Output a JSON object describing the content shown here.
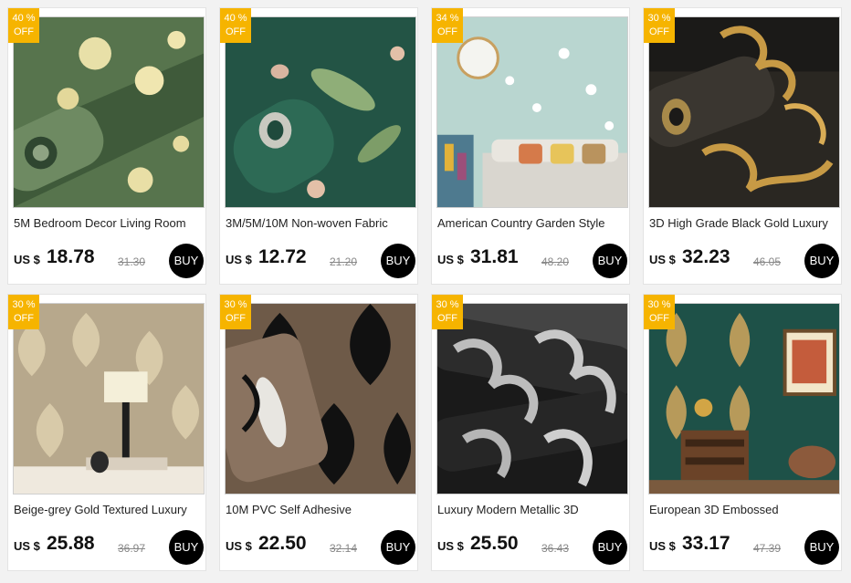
{
  "products": [
    {
      "discount_value": "40 %",
      "discount_label": "OFF",
      "title": "5M Bedroom Decor Living Room",
      "currency": "US $",
      "price": "18.78",
      "old_price": "31.30",
      "buy_label": "BUY",
      "image_icon": "green-floral-wallpaper-roll"
    },
    {
      "discount_value": "40 %",
      "discount_label": "OFF",
      "title": "3M/5M/10M Non-woven Fabric",
      "currency": "US $",
      "price": "12.72",
      "old_price": "21.20",
      "buy_label": "BUY",
      "image_icon": "teal-bird-leaf-wallpaper-roll"
    },
    {
      "discount_value": "34 %",
      "discount_label": "OFF",
      "title": "American Country Garden Style",
      "currency": "US $",
      "price": "31.81",
      "old_price": "48.20",
      "buy_label": "BUY",
      "image_icon": "floral-wall-living-room"
    },
    {
      "discount_value": "30 %",
      "discount_label": "OFF",
      "title": "3D High Grade Black Gold Luxury",
      "currency": "US $",
      "price": "32.23",
      "old_price": "46.05",
      "buy_label": "BUY",
      "image_icon": "black-gold-damask-roll"
    },
    {
      "discount_value": "30 %",
      "discount_label": "OFF",
      "title": "Beige-grey Gold Textured Luxury",
      "currency": "US $",
      "price": "25.88",
      "old_price": "36.97",
      "buy_label": "BUY",
      "image_icon": "beige-damask-bedroom"
    },
    {
      "discount_value": "30 %",
      "discount_label": "OFF",
      "title": "10M PVC Self Adhesive",
      "currency": "US $",
      "price": "22.50",
      "old_price": "32.14",
      "buy_label": "BUY",
      "image_icon": "black-damask-adhesive-roll"
    },
    {
      "discount_value": "30 %",
      "discount_label": "OFF",
      "title": "Luxury Modern Metallic 3D",
      "currency": "US $",
      "price": "25.50",
      "old_price": "36.43",
      "buy_label": "BUY",
      "image_icon": "silver-black-damask-rolls"
    },
    {
      "discount_value": "30 %",
      "discount_label": "OFF",
      "title": "European 3D Embossed",
      "currency": "US $",
      "price": "33.17",
      "old_price": "47.39",
      "buy_label": "BUY",
      "image_icon": "green-damask-room"
    }
  ],
  "colors": {
    "badge": "#f6b400",
    "buy_button": "#000000",
    "page_background": "#f2f2f2"
  }
}
